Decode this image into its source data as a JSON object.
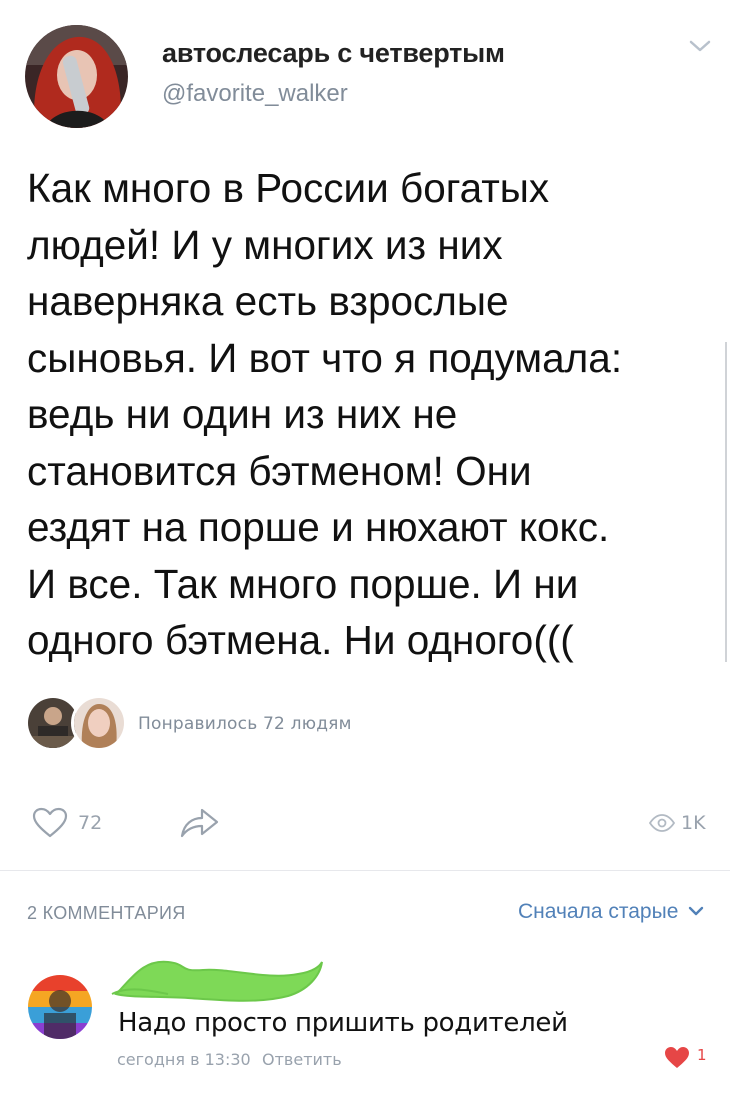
{
  "post": {
    "author_name": "автослесарь с четвертым",
    "author_handle": "@favorite_walker",
    "text_lines": [
      "Как много в России богатых",
      "людей! И у многих из них",
      "наверняка есть взрослые",
      "сыновья. И вот что я подумала:",
      "ведь ни один из них не",
      "становится бэтменом! Они",
      "ездят на порше и нюхают кокс.",
      "И все. Так много порше. И ни",
      "одного бэтмена. Ни одного((("
    ],
    "liked_by_text": "Понравилось 72 людям",
    "likes_count": "72",
    "views_count": "1K"
  },
  "comments": {
    "count_label": "2 КОММЕНТАРИЯ",
    "sort_label": "Сначала старые",
    "items": [
      {
        "text": "Надо просто пришить родителей",
        "time": "сегодня в 13:30",
        "reply_label": "Ответить",
        "likes": "1"
      }
    ]
  },
  "colors": {
    "accent": "#5181b8",
    "muted": "#818c99",
    "like_red": "#e64646",
    "scribble_green": "#7ed957"
  },
  "icons": {
    "menu": "chevron-down-icon",
    "like": "heart-outline-icon",
    "share": "share-arrow-icon",
    "views": "eye-icon",
    "comment_like": "heart-filled-icon"
  }
}
